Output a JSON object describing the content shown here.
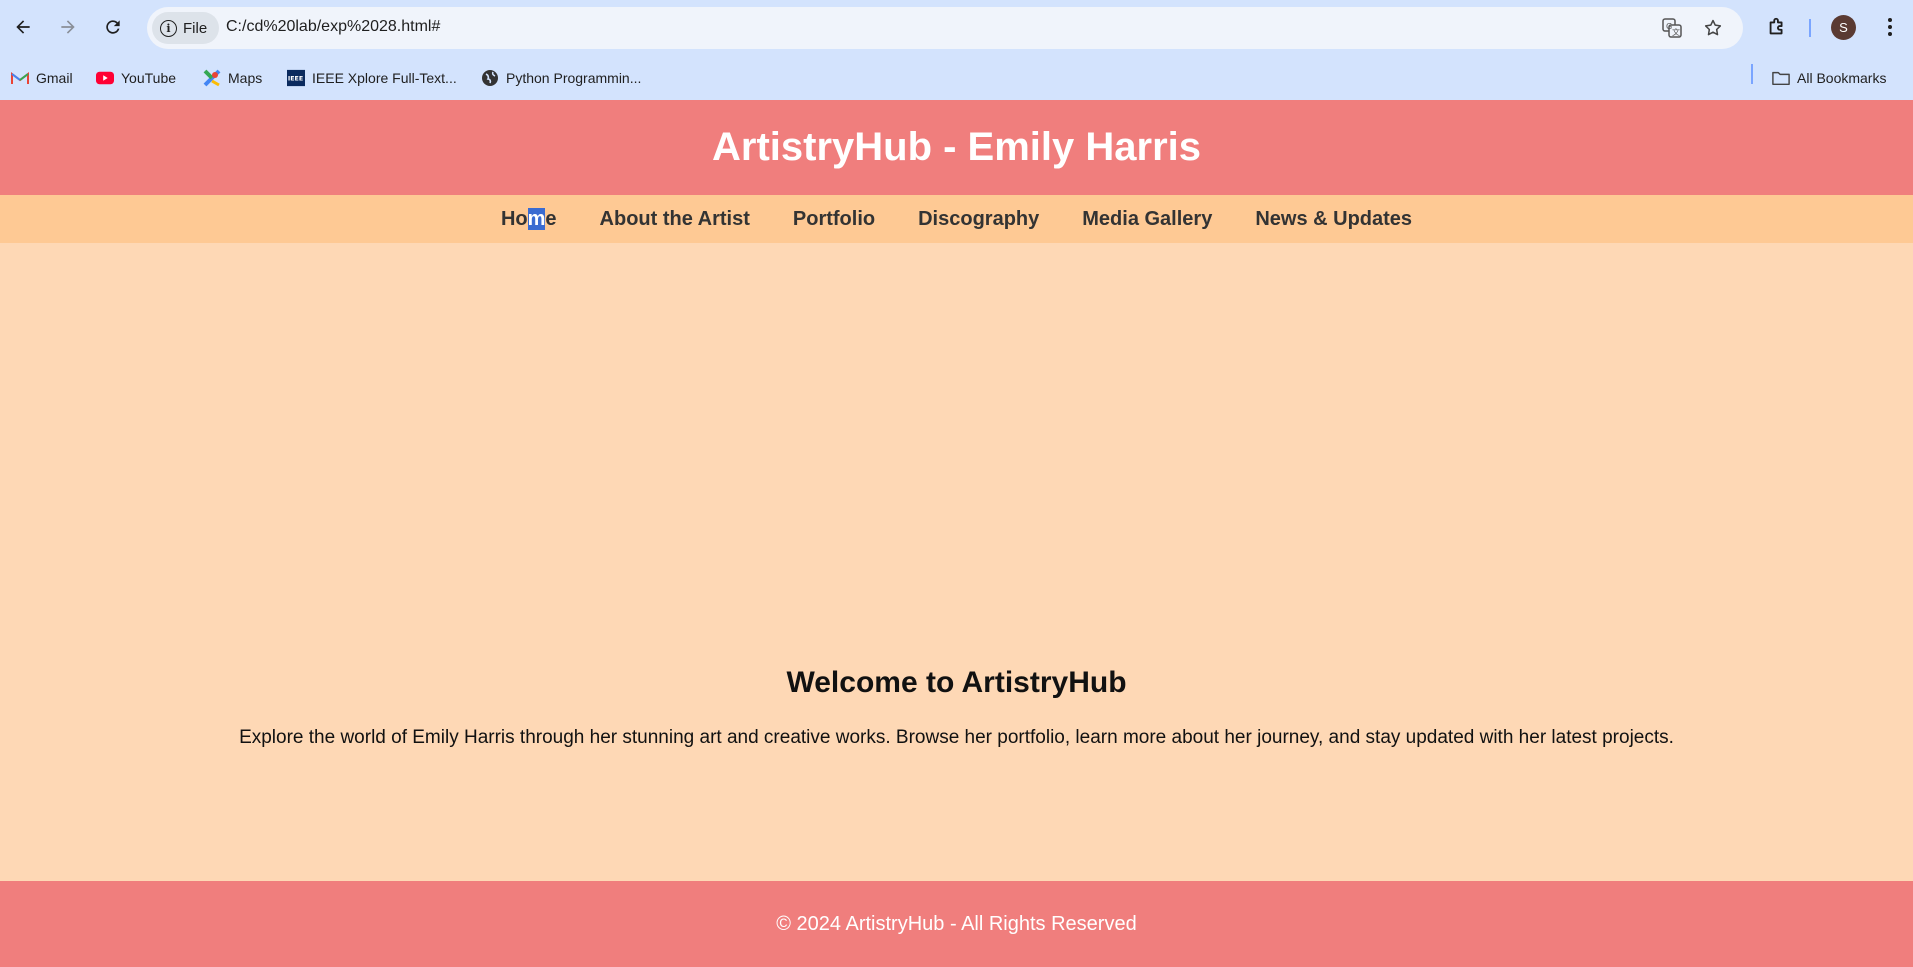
{
  "browser": {
    "url": "C:/cd%20lab/exp%2028.html#",
    "chip_label": "File",
    "profile_initial": "S",
    "bookmarks": [
      {
        "label": "Gmail",
        "icon": "gmail-icon"
      },
      {
        "label": "YouTube",
        "icon": "youtube-icon"
      },
      {
        "label": "Maps",
        "icon": "maps-icon"
      },
      {
        "label": "IEEE Xplore Full-Text...",
        "icon": "ieee-icon"
      },
      {
        "label": "Python Programmin...",
        "icon": "globe-icon"
      }
    ],
    "all_bookmarks": "All Bookmarks"
  },
  "site": {
    "title": "ArtistryHub - Emily Harris",
    "nav": {
      "home_pre": "Ho",
      "home_sel": "m",
      "home_post": "e",
      "items": [
        "About the Artist",
        "Portfolio",
        "Discography",
        "Media Gallery",
        "News & Updates"
      ]
    },
    "welcome_heading": "Welcome to ArtistryHub",
    "intro": "Explore the world of Emily Harris through her stunning art and creative works. Browse her portfolio, learn more about her journey, and stay updated with her latest projects.",
    "footer": "© 2024 ArtistryHub - All Rights Reserved"
  },
  "colors": {
    "header_bg": "#f07e7d",
    "nav_bg": "#fec994",
    "page_bg": "#fed8b5",
    "chrome_bg": "#d3e3fd"
  }
}
